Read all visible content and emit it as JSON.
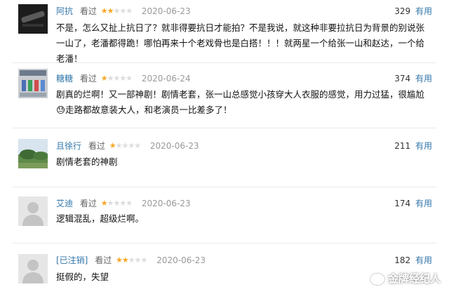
{
  "reviews": [
    {
      "user": "阿抗",
      "watched": "看过",
      "rating": 2,
      "date": "2020-06-23",
      "votes": "329",
      "useful": "有用",
      "content": "不是，怎么又扯上抗日了？就非得要抗日才能拍？不是我说，就这种非要拉抗日为背景的别说张一山了，老潘都得跪！哪怕再来十个老戏骨也是白搭！！！就两星一个给张一山和赵达，一个给老潘！"
    },
    {
      "user": "糖糖",
      "watched": "看过",
      "rating": 1,
      "date": "2020-06-24",
      "votes": "374",
      "useful": "有用",
      "content": "剧真的烂啊！又一部神剧！剧情老套，张一山总感觉小孩穿大人衣服的感觉，用力过猛，很尴尬😓走路都故意装大人，和老演员一比差多了！"
    },
    {
      "user": "且徐行",
      "watched": "看过",
      "rating": 1,
      "date": "2020-06-23",
      "votes": "211",
      "useful": "有用",
      "content": "剧情老套的神剧"
    },
    {
      "user": "艾迪",
      "watched": "看过",
      "rating": 1,
      "date": "2020-06-23",
      "votes": "174",
      "useful": "有用",
      "content": "逻辑混乱，超级烂啊。"
    },
    {
      "user": "[已注销]",
      "watched": "看过",
      "rating": 2,
      "date": "2020-06-23",
      "votes": "182",
      "useful": "有用",
      "content": "挺假的，失望"
    }
  ],
  "watermark": "金牌经纪人",
  "colors": {
    "link": "#3377aa",
    "star_on": "#f6a623",
    "star_off": "#dcdcdc",
    "date": "#999999"
  }
}
